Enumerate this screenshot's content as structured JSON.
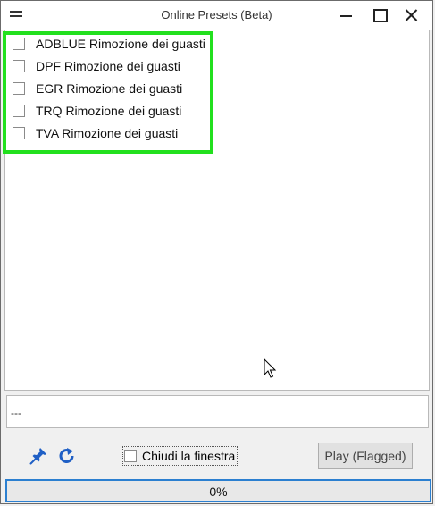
{
  "window": {
    "title": "Online Presets (Beta)"
  },
  "presets": [
    {
      "label": "ADBLUE Rimozione dei guasti",
      "checked": false
    },
    {
      "label": "DPF Rimozione dei guasti",
      "checked": false
    },
    {
      "label": "EGR Rimozione dei guasti",
      "checked": false
    },
    {
      "label": "TRQ Rimozione dei guasti",
      "checked": false
    },
    {
      "label": "TVA Rimozione dei guasti",
      "checked": false
    }
  ],
  "log": {
    "text": "---"
  },
  "toolbar": {
    "pin_icon": "pin-icon",
    "refresh_icon": "refresh-icon",
    "close_window_label": "Chiudi la finestra",
    "close_window_checked": false,
    "play_label": "Play (Flagged)"
  },
  "progress": {
    "value": 0,
    "text": "0%"
  },
  "colors": {
    "highlight": "#22e01e",
    "progress_border": "#2b7fd0",
    "icon_blue": "#1f5fc5"
  }
}
